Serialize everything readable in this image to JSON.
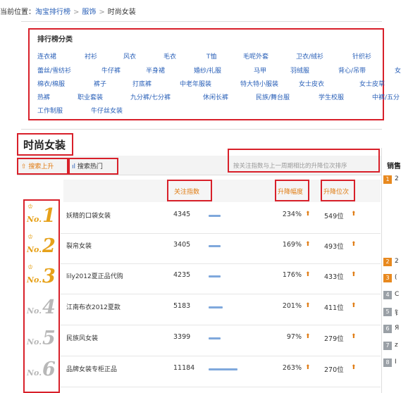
{
  "breadcrumb": {
    "prefix": "当前位置：",
    "links": [
      "淘宝排行榜",
      "服饰"
    ],
    "current": "时尚女装",
    "separator": ">"
  },
  "categories": {
    "title": "排行榜分类",
    "items": [
      "连衣裙",
      "衬衫",
      "风衣",
      "毛衣",
      "T恤",
      "毛呢外套",
      "卫衣/绒衫",
      "针织衫",
      "蕾丝/雪纺衫",
      "牛仔裤",
      "半身裙",
      "婚纱/礼服",
      "马甲",
      "羽绒服",
      "背心/吊带",
      "女",
      "棉衣/棉服",
      "裤子",
      "打底裤",
      "中老年服装",
      "特大特小服装",
      "女士皮衣",
      "女士皮草",
      "热裤",
      "职业套装",
      "九分裤/七分裤",
      "休闲长裤",
      "民族/舞台服",
      "学生校服",
      "中裤/五分",
      "工作制服",
      "牛仔丝女装"
    ]
  },
  "page_title": "时尚女装",
  "tabs": {
    "up": "搜索上升",
    "hot": "搜索热门",
    "sort_note": "按关注指数与上一周期相比的升降位次排序"
  },
  "columns": {
    "attention": "关注指数",
    "change_pct": "升降幅度",
    "change_pos": "升降位次"
  },
  "rows": [
    {
      "rank_prefix": "No.",
      "rank": "1",
      "name": "妖精的口袋女装",
      "attention": "4345",
      "bar": 0.19,
      "pct": "234%",
      "pos": "549位"
    },
    {
      "rank_prefix": "No.",
      "rank": "2",
      "name": "裂帛女装",
      "attention": "3405",
      "bar": 0.19,
      "pct": "169%",
      "pos": "493位"
    },
    {
      "rank_prefix": "No.",
      "rank": "3",
      "name": "lily2012夏正品代购",
      "attention": "4235",
      "bar": 0.19,
      "pct": "176%",
      "pos": "433位"
    },
    {
      "rank_prefix": "No.",
      "rank": "4",
      "name": "江南布衣2012夏款",
      "attention": "5183",
      "bar": 0.22,
      "pct": "201%",
      "pos": "411位"
    },
    {
      "rank_prefix": "No.",
      "rank": "5",
      "name": "民族风女装",
      "attention": "3399",
      "bar": 0.19,
      "pct": "97%",
      "pos": "279位"
    },
    {
      "rank_prefix": "No.",
      "rank": "6",
      "name": "品牌女装专柜正品",
      "attention": "11184",
      "bar": 0.46,
      "pct": "263%",
      "pos": "270位"
    }
  ],
  "side": {
    "title": "销售",
    "items": [
      {
        "n": "1",
        "t": "2"
      },
      {
        "n": "2",
        "t": "2"
      },
      {
        "n": "3",
        "t": "("
      },
      {
        "n": "4",
        "t": "C"
      },
      {
        "n": "5",
        "t": "钅"
      },
      {
        "n": "6",
        "t": "Я"
      },
      {
        "n": "7",
        "t": "z"
      },
      {
        "n": "8",
        "t": "I"
      }
    ]
  },
  "colors": {
    "accent": "#e07b11",
    "link": "#2a60b8",
    "highlight_box": "#d8202a",
    "bar": "#7fa8dc"
  }
}
